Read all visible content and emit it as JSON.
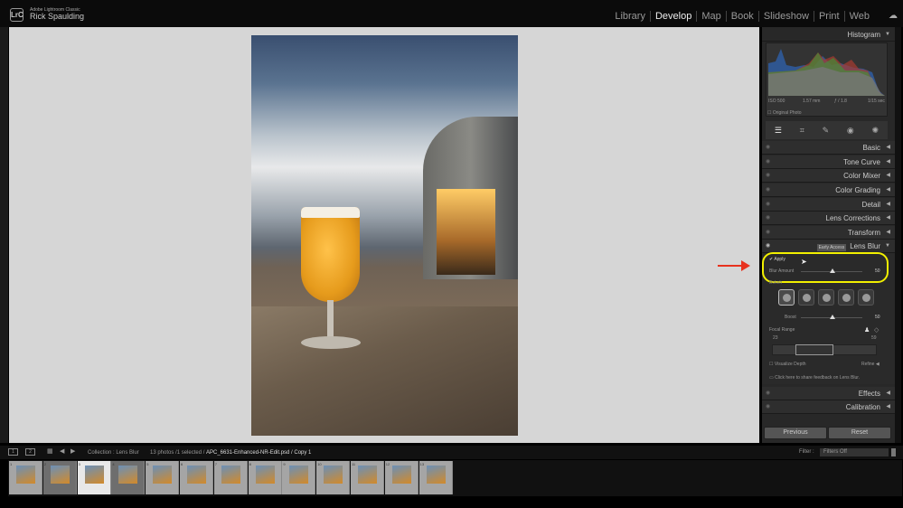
{
  "app": {
    "name": "Adobe Lightroom Classic",
    "logo": "LrC",
    "user": "Rick Spaulding"
  },
  "modules": [
    "Library",
    "Develop",
    "Map",
    "Book",
    "Slideshow",
    "Print",
    "Web"
  ],
  "active_module": "Develop",
  "histogram": {
    "title": "Histogram",
    "iso": "ISO 500",
    "focal": "1.57 mm",
    "aperture": "ƒ / 1.8",
    "shutter": "1/15 sec",
    "original_photo": "Original Photo"
  },
  "tools": [
    "sliders-icon",
    "crop-icon",
    "heal-icon",
    "redeye-icon",
    "mask-icon"
  ],
  "panels": [
    "Basic",
    "Tone Curve",
    "Color Mixer",
    "Color Grading",
    "Detail",
    "Lens Corrections",
    "Transform"
  ],
  "lens_blur": {
    "badge": "Early Access",
    "title": "Lens Blur",
    "apply": "Apply",
    "blur_amount_label": "Blur Amount",
    "blur_amount": 50,
    "bokeh_label": "Bokeh",
    "boost_label": "Boost",
    "boost": 50,
    "focal_range_label": "Focal Range",
    "focal_min": "23",
    "focal_max": "59",
    "visualize": "Visualize Depth",
    "refine": "Refine",
    "feedback": "Click here to share feedback on Lens Blur."
  },
  "panels_bottom": [
    "Effects",
    "Calibration"
  ],
  "buttons": {
    "previous": "Previous",
    "reset": "Reset"
  },
  "filmstrip": {
    "view1": "1",
    "view2": "2",
    "collection": "Collection : Lens Blur",
    "info": "13 photos /1 selected /",
    "file": "APC_6631-Enhanced-NR-Edit.psd / Copy 1",
    "filter_label": "Filter :",
    "filter_value": "Filters Off",
    "selected": 3,
    "thumbs": [
      "1",
      "2",
      "3",
      "4",
      "5",
      "6",
      "7",
      "8",
      "9",
      "10",
      "11",
      "12",
      "13"
    ]
  },
  "colors": {
    "highlight": "#f2f000",
    "arrow": "#e8321e"
  }
}
